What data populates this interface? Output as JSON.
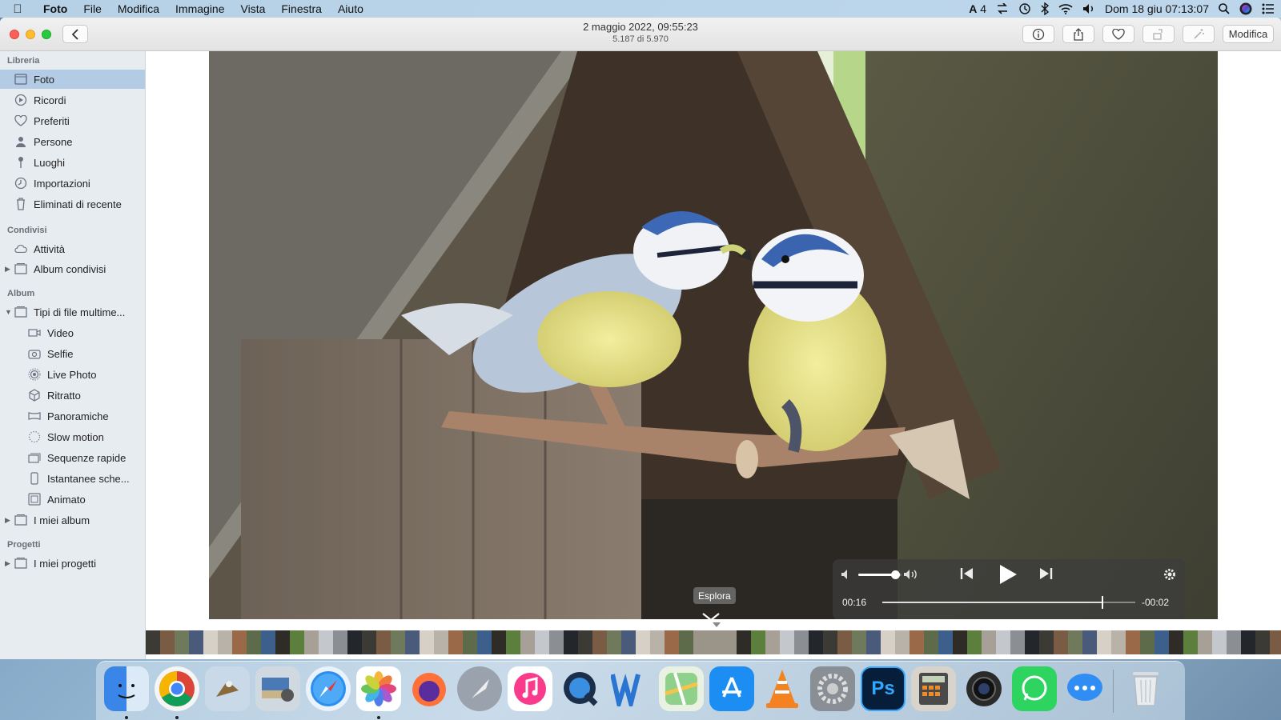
{
  "menubar": {
    "app_name": "Foto",
    "items": [
      "File",
      "Modifica",
      "Immagine",
      "Vista",
      "Finestra",
      "Aiuto"
    ],
    "input_badge": "4",
    "clock": "Dom 18 giu  07:13:07"
  },
  "window": {
    "photo_date": "2 maggio 2022, 09:55:23",
    "photo_count": "5.187 di 5.970",
    "edit_label": "Modifica"
  },
  "sidebar": {
    "library_header": "Libreria",
    "library_items": [
      "Foto",
      "Ricordi",
      "Preferiti",
      "Persone",
      "Luoghi",
      "Importazioni",
      "Eliminati di recente"
    ],
    "shared_header": "Condivisi",
    "shared_items": [
      "Attività",
      "Album condivisi"
    ],
    "album_header": "Album",
    "album_group": "Tipi di file multime...",
    "media_types": [
      "Video",
      "Selfie",
      "Live Photo",
      "Ritratto",
      "Panoramiche",
      "Slow motion",
      "Sequenze rapide",
      "Istantanee sche...",
      "Animato"
    ],
    "my_albums": "I miei album",
    "projects_header": "Progetti",
    "my_projects": "I miei progetti"
  },
  "viewer": {
    "explore_label": "Esplora"
  },
  "video": {
    "elapsed": "00:16",
    "remaining": "-00:02",
    "progress": 0.87,
    "volume": 0.85
  },
  "colors": {
    "selection": "#b4cbe6",
    "sidebar_bg": "#e7ecf1",
    "close": "#fe5f57",
    "minimize": "#febc2e",
    "maximize": "#28c840"
  },
  "dock": {
    "apps": [
      "finder-icon",
      "chrome-icon",
      "preview-bird-icon",
      "image-capture-icon",
      "safari-icon",
      "photos-icon",
      "firefox-icon",
      "launchpad-icon",
      "music-icon",
      "quicktime-icon",
      "word-icon",
      "maps-icon",
      "app-store-icon",
      "vlc-icon",
      "system-preferences-icon",
      "photoshop-icon",
      "calculator-icon",
      "camera-icon",
      "whatsapp-icon",
      "messenger-icon",
      "trash-icon"
    ]
  }
}
